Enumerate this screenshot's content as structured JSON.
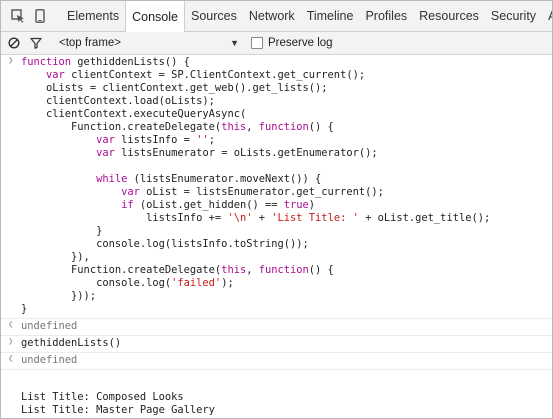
{
  "toolbar_icons": [
    "inspect-icon",
    "device-icon"
  ],
  "tabs": [
    {
      "label": "Elements"
    },
    {
      "label": "Console"
    },
    {
      "label": "Sources"
    },
    {
      "label": "Network"
    },
    {
      "label": "Timeline"
    },
    {
      "label": "Profiles"
    },
    {
      "label": "Resources"
    },
    {
      "label": "Security"
    },
    {
      "label": "Audits"
    }
  ],
  "console_toolbar": {
    "frame_select": "<top frame>",
    "preserve_log_label": "Preserve log",
    "preserve_log_checked": false
  },
  "code_input": [
    [
      [
        "kw",
        "function"
      ],
      [
        "t",
        " gethiddenLists() {"
      ]
    ],
    [
      [
        "t",
        "    "
      ],
      [
        "kw",
        "var"
      ],
      [
        "t",
        " clientContext = SP.ClientContext.get_current();"
      ]
    ],
    [
      [
        "t",
        "    oLists = clientContext.get_web().get_lists();"
      ]
    ],
    [
      [
        "t",
        "    clientContext.load(oLists);"
      ]
    ],
    [
      [
        "t",
        "    clientContext.executeQueryAsync("
      ]
    ],
    [
      [
        "t",
        "        Function.createDelegate("
      ],
      [
        "kw",
        "this"
      ],
      [
        "t",
        ", "
      ],
      [
        "kw",
        "function"
      ],
      [
        "t",
        "() {"
      ]
    ],
    [
      [
        "t",
        "            "
      ],
      [
        "kw",
        "var"
      ],
      [
        "t",
        " listsInfo = "
      ],
      [
        "str",
        "''"
      ],
      [
        "t",
        ";"
      ]
    ],
    [
      [
        "t",
        "            "
      ],
      [
        "kw",
        "var"
      ],
      [
        "t",
        " listsEnumerator = oLists.getEnumerator();"
      ]
    ],
    [
      [
        "t",
        ""
      ]
    ],
    [
      [
        "t",
        "            "
      ],
      [
        "kw",
        "while"
      ],
      [
        "t",
        " (listsEnumerator.moveNext()) {"
      ]
    ],
    [
      [
        "t",
        "                "
      ],
      [
        "kw",
        "var"
      ],
      [
        "t",
        " oList = listsEnumerator.get_current();"
      ]
    ],
    [
      [
        "t",
        "                "
      ],
      [
        "kw",
        "if"
      ],
      [
        "t",
        " (oList.get_hidden() == "
      ],
      [
        "kw",
        "true"
      ],
      [
        "t",
        ")"
      ]
    ],
    [
      [
        "t",
        "                    listsInfo += "
      ],
      [
        "str",
        "'\\n'"
      ],
      [
        "t",
        " + "
      ],
      [
        "str",
        "'List Title: '"
      ],
      [
        "t",
        " + oList.get_title();"
      ]
    ],
    [
      [
        "t",
        "            }"
      ]
    ],
    [
      [
        "t",
        "            console.log(listsInfo.toString());"
      ]
    ],
    [
      [
        "t",
        "        }),"
      ]
    ],
    [
      [
        "t",
        "        Function.createDelegate("
      ],
      [
        "kw",
        "this"
      ],
      [
        "t",
        ", "
      ],
      [
        "kw",
        "function"
      ],
      [
        "t",
        "() {"
      ]
    ],
    [
      [
        "t",
        "            console.log("
      ],
      [
        "str",
        "'failed'"
      ],
      [
        "t",
        ");"
      ]
    ],
    [
      [
        "t",
        "        }));"
      ]
    ],
    [
      [
        "t",
        "}"
      ]
    ]
  ],
  "result_1": "undefined",
  "call_input": "gethiddenLists()",
  "result_2": "undefined",
  "log_output": [
    "",
    "List Title: Composed Looks",
    "List Title: Master Page Gallery"
  ]
}
